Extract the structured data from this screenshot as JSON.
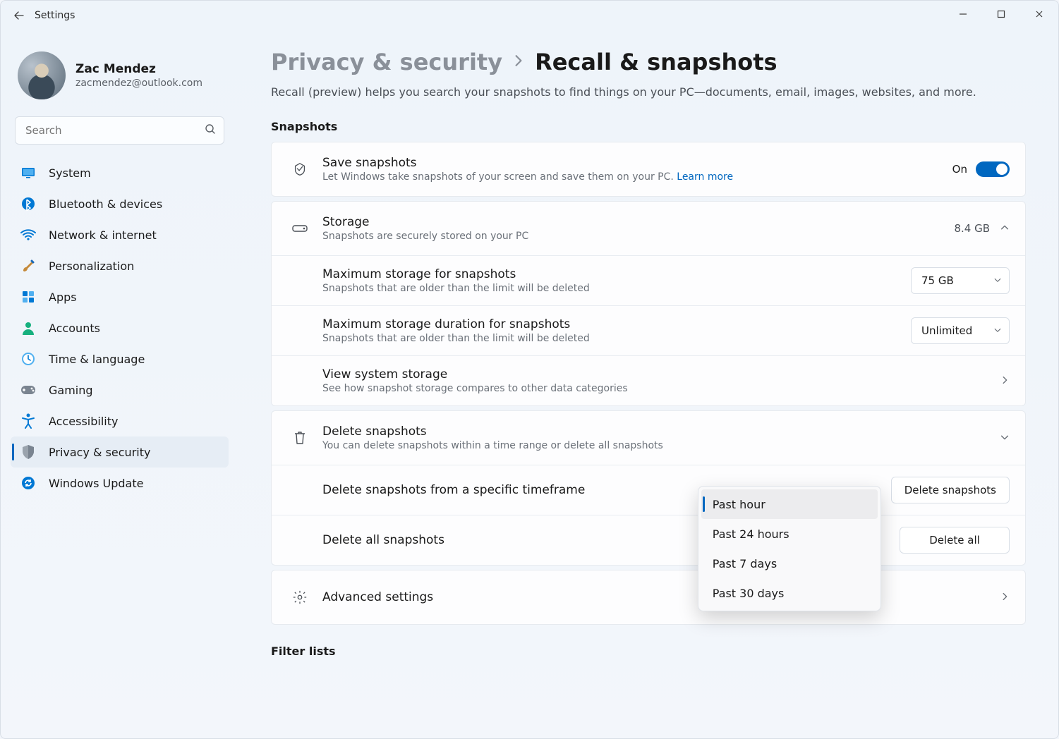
{
  "window": {
    "title": "Settings"
  },
  "profile": {
    "name": "Zac Mendez",
    "email": "zacmendez@outlook.com"
  },
  "search": {
    "placeholder": "Search"
  },
  "sidebar": {
    "items": [
      {
        "label": "System",
        "icon": "system"
      },
      {
        "label": "Bluetooth & devices",
        "icon": "bluetooth"
      },
      {
        "label": "Network & internet",
        "icon": "wifi"
      },
      {
        "label": "Personalization",
        "icon": "brush"
      },
      {
        "label": "Apps",
        "icon": "apps"
      },
      {
        "label": "Accounts",
        "icon": "person"
      },
      {
        "label": "Time & language",
        "icon": "clock"
      },
      {
        "label": "Gaming",
        "icon": "gamepad"
      },
      {
        "label": "Accessibility",
        "icon": "accessibility"
      },
      {
        "label": "Privacy & security",
        "icon": "shield"
      },
      {
        "label": "Windows Update",
        "icon": "update"
      }
    ],
    "active_index": 9
  },
  "breadcrumb": {
    "parent": "Privacy & security",
    "current": "Recall & snapshots"
  },
  "page": {
    "description": "Recall (preview) helps you search your snapshots to find things on your PC—documents, email, images, websites, and more."
  },
  "sections": {
    "snapshots_heading": "Snapshots",
    "filter_heading": "Filter lists"
  },
  "save": {
    "title": "Save snapshots",
    "sub": "Let Windows take snapshots of your screen and save them on your PC. ",
    "learn_more": "Learn more",
    "toggle_state": "On"
  },
  "storage": {
    "title": "Storage",
    "sub": "Snapshots are securely stored on your PC",
    "used": "8.4 GB",
    "max_storage": {
      "title": "Maximum storage for snapshots",
      "sub": "Snapshots that are older than the limit will be deleted",
      "value": "75 GB"
    },
    "max_duration": {
      "title": "Maximum storage duration for snapshots",
      "sub": "Snapshots that are older than the limit will be deleted",
      "value": "Unlimited"
    },
    "view_storage": {
      "title": "View system storage",
      "sub": "See how snapshot storage compares to other data categories"
    }
  },
  "delete": {
    "title": "Delete snapshots",
    "sub": "You can delete snapshots within a time range or delete all snapshots",
    "timeframe": {
      "title": "Delete snapshots from a specific timeframe",
      "button": "Delete snapshots",
      "options": [
        "Past hour",
        "Past 24 hours",
        "Past 7 days",
        "Past 30 days"
      ],
      "selected": "Past hour"
    },
    "all": {
      "title": "Delete all snapshots",
      "button": "Delete all"
    }
  },
  "advanced": {
    "title": "Advanced settings"
  }
}
